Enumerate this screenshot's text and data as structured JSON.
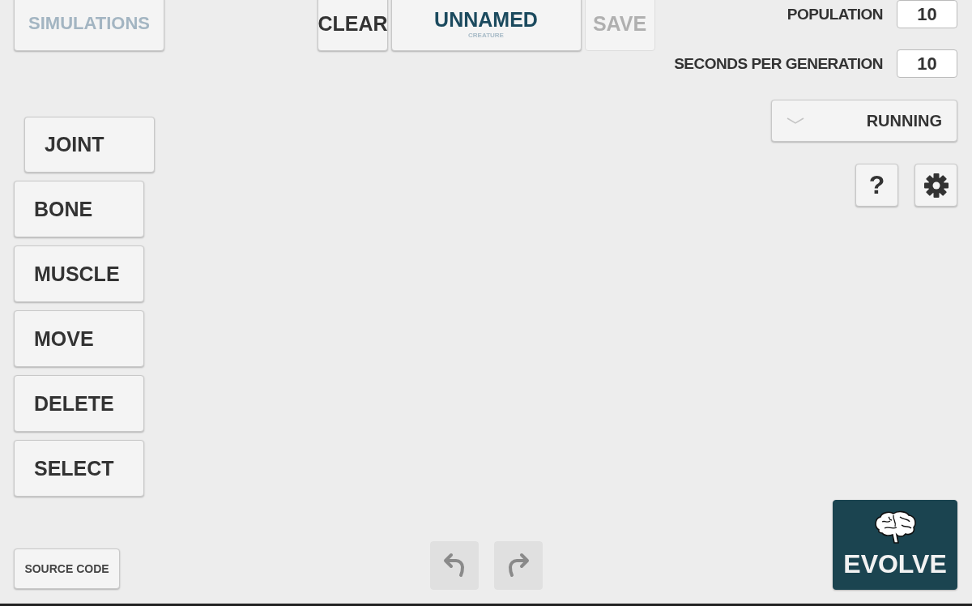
{
  "header": {
    "simulations_button": "SIMULATIONS",
    "clear_button": "CLEAR",
    "creature": {
      "name": "UNNAMED",
      "caption": "CREATURE"
    },
    "save_button": {
      "label": "SAVE",
      "disabled": true
    }
  },
  "settings": {
    "fields": [
      {
        "label": "POPULATION",
        "value": "10"
      },
      {
        "label": "SECONDS PER GENERATION",
        "value": "10"
      }
    ],
    "mode_dropdown": {
      "value": "RUNNING"
    },
    "help_button": "?"
  },
  "tools": [
    {
      "label": "JOINT",
      "selected": true
    },
    {
      "label": "BONE",
      "selected": false
    },
    {
      "label": "MUSCLE",
      "selected": false
    },
    {
      "label": "MOVE",
      "selected": false
    },
    {
      "label": "DELETE",
      "selected": false
    },
    {
      "label": "SELECT",
      "selected": false
    }
  ],
  "history": {
    "undo_disabled": true,
    "redo_disabled": true
  },
  "source_code_button": "SOURCE CODE",
  "evolve_button": "EVOLVE"
}
